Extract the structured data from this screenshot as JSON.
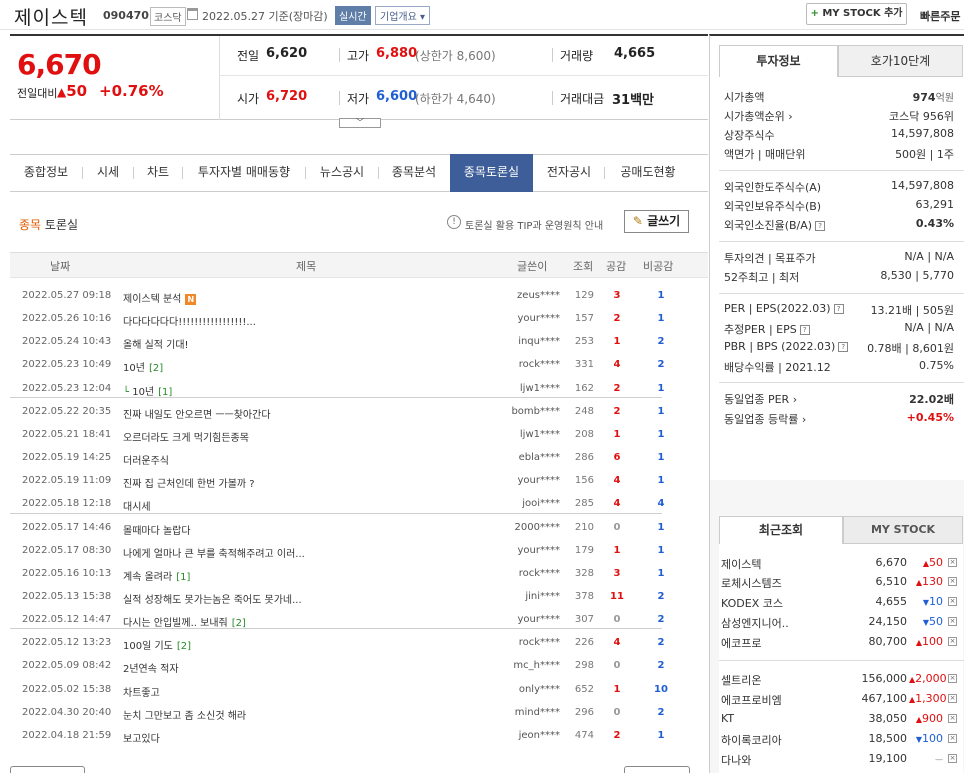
{
  "header": {
    "title": "제이스텍",
    "code": "090470",
    "market": "코스닥",
    "date": "2022.05.27 기준(장마감)",
    "realtime": "실시간",
    "corp_info": "기업개요",
    "mystock_add": "MY STOCK 추가",
    "quick_order": "빠른주문"
  },
  "price": {
    "current": "6,670",
    "change_label": "전일대비",
    "change": "50",
    "change_pct": "+0.76%",
    "prev_label": "전일",
    "prev": "6,620",
    "high_label": "고가",
    "high": "6,880",
    "upper_limit": "(상한가 8,600)",
    "volume_label": "거래량",
    "volume": "4,665",
    "open_label": "시가",
    "open": "6,720",
    "low_label": "저가",
    "low": "6,600",
    "lower_limit": "(하한가 4,640)",
    "amount_label": "거래대금",
    "amount": "31백만",
    "expand": "﹀"
  },
  "tabs": [
    "종합정보",
    "시세",
    "차트",
    "투자자별 매매동향",
    "뉴스공시",
    "종목분석",
    "종목토론실",
    "전자공시",
    "공매도현황"
  ],
  "board": {
    "title_accent": "종목",
    "title_rest": "토론실",
    "tip": "토론실 활용 TIP과 운영원칙 안내",
    "write": "글쓰기",
    "columns": [
      "날짜",
      "제목",
      "글쓴이",
      "조회",
      "공감",
      "비공감"
    ],
    "rows": [
      {
        "date": "2022.05.27 09:18",
        "title": "제이스텍 분석",
        "comments": "",
        "new": "N",
        "reply": false,
        "writer": "zeus****",
        "views": "129",
        "like": "3",
        "dislike": "1"
      },
      {
        "date": "2022.05.26 10:16",
        "title": "다다다다다다!!!!!!!!!!!!!!!!!...",
        "comments": "",
        "new": "",
        "reply": false,
        "writer": "your****",
        "views": "157",
        "like": "2",
        "dislike": "1"
      },
      {
        "date": "2022.05.24 10:43",
        "title": "올해 실적 기대!",
        "comments": "",
        "new": "",
        "reply": false,
        "writer": "inqu****",
        "views": "253",
        "like": "1",
        "dislike": "2"
      },
      {
        "date": "2022.05.23 10:49",
        "title": "10년",
        "comments": "[2]",
        "new": "",
        "reply": false,
        "writer": "rock****",
        "views": "331",
        "like": "4",
        "dislike": "2"
      },
      {
        "date": "2022.05.23 12:04",
        "title": "10년",
        "comments": "[1]",
        "new": "",
        "reply": true,
        "writer": "ljw1****",
        "views": "162",
        "like": "2",
        "dislike": "1"
      },
      {
        "date": "2022.05.22 20:35",
        "title": "진짜 내일도 안오르면 ㅡㅡ찾아간다",
        "comments": "",
        "new": "",
        "reply": false,
        "writer": "bomb****",
        "views": "248",
        "like": "2",
        "dislike": "1"
      },
      {
        "date": "2022.05.21 18:41",
        "title": "오르더라도 크게 먹기힘든종목",
        "comments": "",
        "new": "",
        "reply": false,
        "writer": "ljw1****",
        "views": "208",
        "like": "1",
        "dislike": "1"
      },
      {
        "date": "2022.05.19 14:25",
        "title": "더러운주식",
        "comments": "",
        "new": "",
        "reply": false,
        "writer": "ebla****",
        "views": "286",
        "like": "6",
        "dislike": "1"
      },
      {
        "date": "2022.05.19 11:09",
        "title": "진짜 집 근처인데 한번 가볼까 ?",
        "comments": "",
        "new": "",
        "reply": false,
        "writer": "your****",
        "views": "156",
        "like": "4",
        "dislike": "1"
      },
      {
        "date": "2022.05.18 12:18",
        "title": "대시세",
        "comments": "",
        "new": "",
        "reply": false,
        "writer": "jooi****",
        "views": "285",
        "like": "4",
        "dislike": "4"
      },
      {
        "date": "2022.05.17 14:46",
        "title": "몰때마다 놀랍다",
        "comments": "",
        "new": "",
        "reply": false,
        "writer": "2000****",
        "views": "210",
        "like": "0",
        "dislike": "1"
      },
      {
        "date": "2022.05.17 08:30",
        "title": "나에게 얼마나 큰 부를 축적해주려고 이러...",
        "comments": "",
        "new": "",
        "reply": false,
        "writer": "your****",
        "views": "179",
        "like": "1",
        "dislike": "1"
      },
      {
        "date": "2022.05.16 10:13",
        "title": "계속 올려라",
        "comments": "[1]",
        "new": "",
        "reply": false,
        "writer": "rock****",
        "views": "328",
        "like": "3",
        "dislike": "1"
      },
      {
        "date": "2022.05.13 15:38",
        "title": "실적 성장해도 못가는놈은 죽어도 못가네...",
        "comments": "",
        "new": "",
        "reply": false,
        "writer": "jini****",
        "views": "378",
        "like": "11",
        "dislike": "2"
      },
      {
        "date": "2022.05.12 14:47",
        "title": "다시는 안입빌께.. 보내줘",
        "comments": "[2]",
        "new": "",
        "reply": false,
        "writer": "your****",
        "views": "307",
        "like": "0",
        "dislike": "2"
      },
      {
        "date": "2022.05.12 13:23",
        "title": "100일 기도",
        "comments": "[2]",
        "new": "",
        "reply": false,
        "writer": "rock****",
        "views": "226",
        "like": "4",
        "dislike": "2"
      },
      {
        "date": "2022.05.09 08:42",
        "title": "2년연속 적자",
        "comments": "",
        "new": "",
        "reply": false,
        "writer": "mc_h****",
        "views": "298",
        "like": "0",
        "dislike": "2"
      },
      {
        "date": "2022.05.02 15:38",
        "title": "차트좋고",
        "comments": "",
        "new": "",
        "reply": false,
        "writer": "only****",
        "views": "652",
        "like": "1",
        "dislike": "10"
      },
      {
        "date": "2022.04.30 20:40",
        "title": "눈치 그만보고 좀 소신것 해라",
        "comments": "",
        "new": "",
        "reply": false,
        "writer": "mind****",
        "views": "296",
        "like": "0",
        "dislike": "2"
      },
      {
        "date": "2022.04.18 21:59",
        "title": "보고있다",
        "comments": "",
        "new": "",
        "reply": false,
        "writer": "jeon****",
        "views": "474",
        "like": "2",
        "dislike": "1"
      }
    ]
  },
  "invest": {
    "tab1": "투자정보",
    "tab2": "호가10단계",
    "rows": [
      {
        "label": "시가총액",
        "value": "974",
        "unit": "억원"
      },
      {
        "label": "시가총액순위 ›",
        "value": "코스닥 956위",
        "unit": ""
      },
      {
        "label": "상장주식수",
        "value": "14,597,808",
        "unit": ""
      },
      {
        "label": "액면가 | 매매단위",
        "value": "500원 | 1주",
        "unit": ""
      },
      {
        "label": "외국인한도주식수(A)",
        "value": "14,597,808",
        "unit": ""
      },
      {
        "label": "외국인보유주식수(B)",
        "value": "63,291",
        "unit": ""
      },
      {
        "label": "외국인소진율(B/A)",
        "value": "0.43%",
        "unit": ""
      },
      {
        "label": "투자의견 | 목표주가",
        "value": "N/A | N/A",
        "unit": ""
      },
      {
        "label": "52주최고 | 최저",
        "value": "8,530 | 5,770",
        "unit": ""
      },
      {
        "label": "PER | EPS(2022.03)",
        "value": "13.21배 | 505원",
        "unit": ""
      },
      {
        "label": "추정PER | EPS",
        "value": "N/A | N/A",
        "unit": ""
      },
      {
        "label": "PBR | BPS (2022.03)",
        "value": "0.78배 | 8,601원",
        "unit": ""
      },
      {
        "label": "배당수익률 | 2021.12",
        "value": "0.75%",
        "unit": ""
      },
      {
        "label": "동일업종 PER ›",
        "value": "22.02배",
        "unit": ""
      },
      {
        "label": "동일업종 등락률 ›",
        "value": "+0.45%",
        "unit": ""
      }
    ]
  },
  "recent": {
    "tab1": "최근조회",
    "tab2": "MY STOCK",
    "items": [
      {
        "name": "제이스텍",
        "price": "6,670",
        "dir": "up",
        "change": "50"
      },
      {
        "name": "로체시스템즈",
        "price": "6,510",
        "dir": "up",
        "change": "130"
      },
      {
        "name": "KODEX 코스",
        "price": "4,655",
        "dir": "down",
        "change": "10"
      },
      {
        "name": "삼성엔지니어..",
        "price": "24,150",
        "dir": "down",
        "change": "50"
      },
      {
        "name": "에코프로",
        "price": "80,700",
        "dir": "up",
        "change": "100"
      },
      {
        "name": "셀트리온",
        "price": "156,000",
        "dir": "up",
        "change": "2,000"
      },
      {
        "name": "에코프로비엠",
        "price": "467,100",
        "dir": "up",
        "change": "1,300"
      },
      {
        "name": "KT",
        "price": "38,050",
        "dir": "up",
        "change": "900"
      },
      {
        "name": "하이록코리아",
        "price": "18,500",
        "dir": "down",
        "change": "100"
      },
      {
        "name": "다나와",
        "price": "19,100",
        "dir": "flat",
        "change": "0"
      }
    ]
  }
}
